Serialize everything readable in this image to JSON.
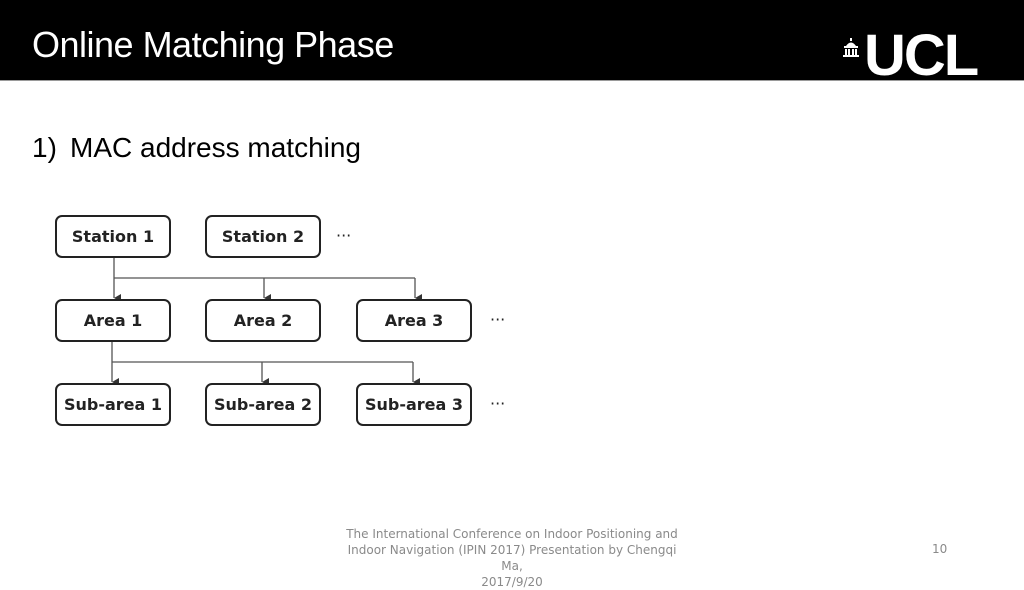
{
  "slide": {
    "title": "Online Matching Phase",
    "logo_text": "UCL",
    "logo_icon": "portico-icon",
    "bullet_number": "1)",
    "bullet_text": "MAC address matching"
  },
  "diagram": {
    "rows": [
      {
        "name": "stations",
        "nodes": [
          "Station 1",
          "Station 2"
        ],
        "ellipsis": "···"
      },
      {
        "name": "areas",
        "nodes": [
          "Area 1",
          "Area 2",
          "Area 3"
        ],
        "ellipsis": "···"
      },
      {
        "name": "sub-areas",
        "nodes": [
          "Sub-area 1",
          "Sub-area 2",
          "Sub-area 3"
        ],
        "ellipsis": "···"
      }
    ],
    "edges": [
      {
        "from": "Station 1",
        "to": [
          "Area 1",
          "Area 2",
          "Area 3"
        ]
      },
      {
        "from": "Area 1",
        "to": [
          "Sub-area 1",
          "Sub-area 2",
          "Sub-area 3"
        ]
      }
    ]
  },
  "footer": {
    "line1": "The International Conference on Indoor Positioning and",
    "line2": "Indoor Navigation (IPIN 2017) Presentation by Chengqi Ma,",
    "line3": "2017/9/20",
    "page_number": "10"
  }
}
